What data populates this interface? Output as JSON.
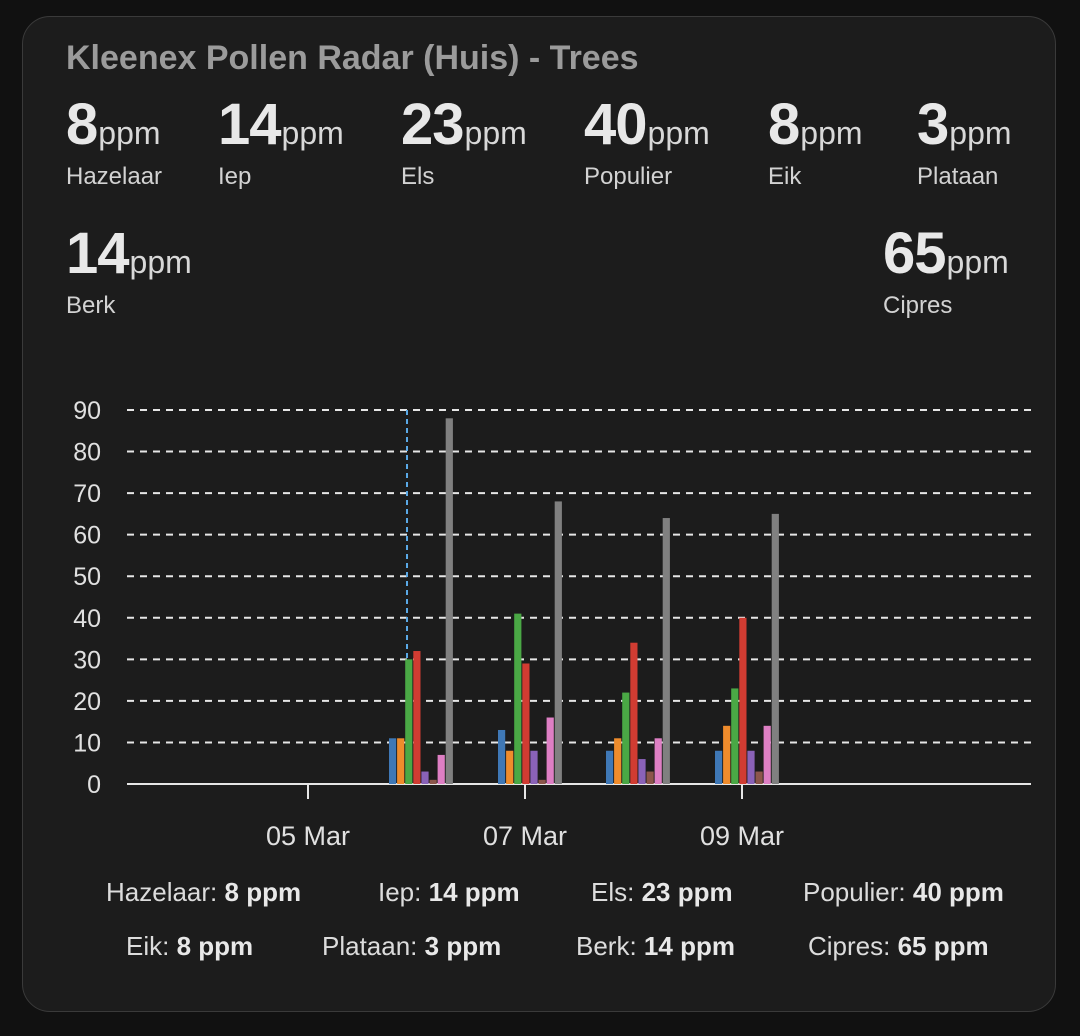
{
  "card": {
    "title": "Kleenex Pollen Radar (Huis) - Trees"
  },
  "stats": [
    {
      "value": "8",
      "unit": "ppm",
      "name": "Hazelaar"
    },
    {
      "value": "14",
      "unit": "ppm",
      "name": "Iep"
    },
    {
      "value": "23",
      "unit": "ppm",
      "name": "Els"
    },
    {
      "value": "40",
      "unit": "ppm",
      "name": "Populier"
    },
    {
      "value": "8",
      "unit": "ppm",
      "name": "Eik"
    },
    {
      "value": "3",
      "unit": "ppm",
      "name": "Plataan"
    },
    {
      "value": "14",
      "unit": "ppm",
      "name": "Berk"
    },
    {
      "value": "65",
      "unit": "ppm",
      "name": "Cipres"
    }
  ],
  "legend": [
    {
      "label": "Hazelaar:",
      "value": "8 ppm"
    },
    {
      "label": "Iep:",
      "value": "14 ppm"
    },
    {
      "label": "Els:",
      "value": "23 ppm"
    },
    {
      "label": "Populier:",
      "value": "40 ppm"
    },
    {
      "label": "Eik:",
      "value": "8 ppm"
    },
    {
      "label": "Plataan:",
      "value": "3 ppm"
    },
    {
      "label": "Berk:",
      "value": "14 ppm"
    },
    {
      "label": "Cipres:",
      "value": "65 ppm"
    }
  ],
  "chart_data": {
    "type": "bar",
    "ylim": [
      0,
      90
    ],
    "yticks": [
      0,
      10,
      20,
      30,
      40,
      50,
      60,
      70,
      80,
      90
    ],
    "xticks": [
      "05 Mar",
      "07 Mar",
      "09 Mar"
    ],
    "grid": true,
    "categories": [
      "06 Mar",
      "07 Mar",
      "08 Mar",
      "09 Mar"
    ],
    "series": [
      {
        "name": "Hazelaar",
        "color": "#3f78b6",
        "values": [
          11,
          13,
          8,
          8
        ]
      },
      {
        "name": "Iep",
        "color": "#ef8c2c",
        "values": [
          11,
          8,
          11,
          14
        ]
      },
      {
        "name": "Els",
        "color": "#4aa845",
        "values": [
          30,
          41,
          22,
          23
        ]
      },
      {
        "name": "Populier",
        "color": "#d13c32",
        "values": [
          32,
          29,
          34,
          40
        ]
      },
      {
        "name": "Eik",
        "color": "#8a62b8",
        "values": [
          3,
          8,
          6,
          8
        ]
      },
      {
        "name": "Plataan",
        "color": "#8c564b",
        "values": [
          1,
          1,
          3,
          3
        ]
      },
      {
        "name": "Berk",
        "color": "#de7fc4",
        "values": [
          7,
          16,
          11,
          14
        ]
      },
      {
        "name": "Cipres",
        "color": "#808080",
        "values": [
          88,
          68,
          64,
          65
        ]
      }
    ]
  }
}
